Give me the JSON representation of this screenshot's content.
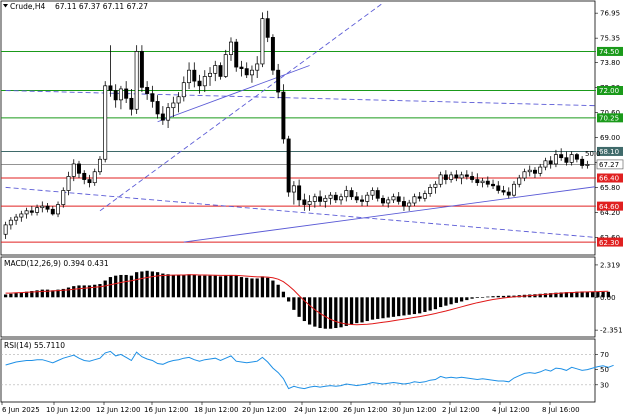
{
  "chart_data": {
    "type": "candlestick",
    "symbol_label": "Crude,H4",
    "ohlc_label": "67.11 67.37 67.11 67.27",
    "price_axis": {
      "ticks": [
        "76.95",
        "75.35",
        "73.80",
        "72.20",
        "70.60",
        "69.00",
        "67.40",
        "65.80",
        "64.20",
        "62.60"
      ],
      "ylim": [
        61.6,
        77.6
      ]
    },
    "x_labels": [
      "6 Jun 2025",
      "10 Jun 12:00",
      "12 Jun 12:00",
      "16 Jun 12:00",
      "18 Jun 12:00",
      "20 Jun 12:00",
      "24 Jun 12:00",
      "26 Jun 12:00",
      "30 Jun 12:00",
      "2 Jul 12:00",
      "4 Jul 12:00",
      "8 Jul 16:00"
    ],
    "levels": [
      {
        "label": "74.50",
        "value": 74.5,
        "color": "#1a9a1a",
        "kind": "resistance"
      },
      {
        "label": "72.00",
        "value": 72.0,
        "color": "#1a9a1a",
        "kind": "resistance"
      },
      {
        "label": "70.25",
        "value": 70.25,
        "color": "#1a9a1a",
        "kind": "resistance"
      },
      {
        "label": "68.10",
        "value": 68.1,
        "color": "#3f6a6a",
        "kind": "fib"
      },
      {
        "label": "67.27",
        "value": 67.27,
        "color": "#555555",
        "kind": "current"
      },
      {
        "label": "66.40",
        "value": 66.4,
        "color": "#e02020",
        "kind": "support"
      },
      {
        "label": "64.60",
        "value": 64.6,
        "color": "#e02020",
        "kind": "support"
      },
      {
        "label": "62.30",
        "value": 62.3,
        "color": "#e02020",
        "kind": "support"
      }
    ],
    "fib_label": "50.0",
    "candles": [
      [
        62.8,
        63.6,
        62.5,
        63.4
      ],
      [
        63.4,
        63.9,
        63.1,
        63.7
      ],
      [
        63.7,
        64.1,
        63.4,
        63.9
      ],
      [
        63.9,
        64.3,
        63.6,
        64.1
      ],
      [
        64.1,
        64.5,
        63.8,
        64.3
      ],
      [
        64.3,
        64.6,
        64.0,
        64.2
      ],
      [
        64.2,
        64.7,
        64.0,
        64.5
      ],
      [
        64.5,
        64.9,
        64.2,
        64.6
      ],
      [
        64.6,
        64.8,
        64.2,
        64.4
      ],
      [
        64.4,
        64.6,
        64.0,
        64.1
      ],
      [
        64.1,
        64.9,
        63.9,
        64.7
      ],
      [
        64.7,
        65.8,
        64.5,
        65.6
      ],
      [
        65.6,
        66.8,
        65.3,
        66.5
      ],
      [
        66.5,
        67.6,
        66.2,
        67.3
      ],
      [
        67.3,
        67.5,
        66.4,
        66.7
      ],
      [
        66.7,
        66.9,
        66.0,
        66.3
      ],
      [
        66.3,
        66.6,
        65.8,
        66.1
      ],
      [
        66.1,
        67.0,
        65.9,
        66.8
      ],
      [
        66.8,
        67.8,
        66.6,
        67.6
      ],
      [
        67.6,
        72.6,
        67.4,
        72.3
      ],
      [
        72.3,
        74.9,
        71.6,
        72.0
      ],
      [
        72.0,
        72.4,
        70.9,
        71.4
      ],
      [
        71.4,
        72.3,
        70.8,
        72.1
      ],
      [
        72.1,
        72.6,
        71.2,
        71.5
      ],
      [
        71.5,
        72.1,
        70.4,
        70.8
      ],
      [
        70.8,
        74.9,
        70.5,
        74.5
      ],
      [
        74.5,
        74.9,
        71.9,
        72.2
      ],
      [
        72.2,
        72.6,
        71.4,
        71.8
      ],
      [
        71.8,
        72.3,
        70.9,
        71.3
      ],
      [
        71.3,
        71.7,
        70.2,
        70.5
      ],
      [
        70.5,
        71.0,
        69.8,
        70.1
      ],
      [
        70.1,
        71.2,
        69.6,
        70.9
      ],
      [
        70.9,
        71.6,
        70.3,
        71.2
      ],
      [
        71.2,
        71.9,
        70.6,
        71.6
      ],
      [
        71.6,
        72.9,
        71.3,
        72.5
      ],
      [
        72.5,
        73.8,
        72.1,
        73.3
      ],
      [
        73.3,
        73.8,
        72.2,
        72.6
      ],
      [
        72.6,
        73.0,
        71.8,
        72.3
      ],
      [
        72.3,
        73.3,
        71.9,
        72.9
      ],
      [
        72.9,
        73.5,
        72.3,
        73.1
      ],
      [
        73.1,
        73.9,
        72.6,
        73.6
      ],
      [
        73.6,
        73.8,
        72.7,
        72.9
      ],
      [
        72.9,
        74.6,
        72.8,
        74.3
      ],
      [
        74.3,
        75.4,
        73.9,
        75.1
      ],
      [
        75.1,
        75.3,
        73.2,
        73.5
      ],
      [
        73.5,
        73.9,
        72.9,
        73.4
      ],
      [
        73.4,
        73.8,
        72.8,
        73.0
      ],
      [
        73.0,
        73.6,
        72.5,
        73.3
      ],
      [
        73.3,
        74.2,
        72.8,
        73.7
      ],
      [
        73.7,
        77.0,
        73.5,
        76.6
      ],
      [
        76.6,
        77.1,
        75.1,
        75.4
      ],
      [
        75.4,
        75.6,
        73.0,
        73.3
      ],
      [
        73.3,
        73.7,
        71.5,
        71.9
      ],
      [
        71.9,
        72.4,
        68.6,
        68.9
      ],
      [
        68.9,
        69.1,
        65.2,
        65.5
      ],
      [
        65.5,
        66.2,
        64.7,
        65.9
      ],
      [
        65.9,
        66.3,
        64.6,
        65.0
      ],
      [
        65.0,
        65.4,
        64.3,
        64.7
      ],
      [
        64.7,
        65.3,
        64.3,
        64.9
      ],
      [
        64.9,
        65.4,
        64.5,
        65.2
      ],
      [
        65.2,
        65.6,
        64.6,
        64.9
      ],
      [
        64.9,
        65.3,
        64.5,
        65.1
      ],
      [
        65.1,
        65.5,
        64.7,
        65.3
      ],
      [
        65.3,
        65.5,
        64.8,
        65.0
      ],
      [
        65.0,
        65.4,
        64.7,
        65.2
      ],
      [
        65.2,
        65.9,
        64.9,
        65.6
      ],
      [
        65.6,
        65.8,
        65.0,
        65.2
      ],
      [
        65.2,
        65.5,
        64.8,
        65.0
      ],
      [
        65.0,
        65.3,
        64.6,
        64.9
      ],
      [
        64.9,
        65.5,
        64.6,
        65.3
      ],
      [
        65.3,
        65.8,
        65.0,
        65.6
      ],
      [
        65.6,
        65.8,
        64.9,
        65.1
      ],
      [
        65.1,
        65.3,
        64.6,
        64.8
      ],
      [
        64.8,
        65.2,
        64.5,
        65.0
      ],
      [
        65.0,
        65.4,
        64.8,
        65.2
      ],
      [
        65.2,
        65.5,
        64.7,
        64.9
      ],
      [
        64.9,
        65.2,
        64.3,
        64.6
      ],
      [
        64.6,
        65.0,
        64.3,
        64.8
      ],
      [
        64.8,
        65.4,
        64.6,
        65.2
      ],
      [
        65.2,
        65.5,
        64.9,
        65.1
      ],
      [
        65.1,
        65.6,
        64.9,
        65.4
      ],
      [
        65.4,
        66.0,
        65.2,
        65.8
      ],
      [
        65.8,
        66.2,
        65.4,
        66.0
      ],
      [
        66.0,
        66.8,
        65.8,
        66.6
      ],
      [
        66.6,
        66.9,
        66.0,
        66.3
      ],
      [
        66.3,
        66.8,
        66.1,
        66.6
      ],
      [
        66.6,
        66.9,
        66.2,
        66.4
      ],
      [
        66.4,
        66.8,
        66.0,
        66.6
      ],
      [
        66.6,
        66.9,
        66.3,
        66.5
      ],
      [
        66.5,
        66.8,
        66.1,
        66.3
      ],
      [
        66.3,
        66.7,
        65.9,
        66.1
      ],
      [
        66.1,
        66.4,
        65.8,
        66.2
      ],
      [
        66.2,
        66.5,
        65.8,
        66.0
      ],
      [
        66.0,
        66.3,
        65.7,
        65.9
      ],
      [
        65.9,
        66.2,
        65.4,
        65.6
      ],
      [
        65.6,
        65.9,
        65.3,
        65.5
      ],
      [
        65.5,
        65.8,
        65.1,
        65.3
      ],
      [
        65.3,
        66.2,
        65.2,
        66.0
      ],
      [
        66.0,
        66.6,
        65.8,
        66.4
      ],
      [
        66.4,
        67.0,
        66.2,
        66.8
      ],
      [
        66.8,
        67.2,
        66.5,
        66.9
      ],
      [
        66.9,
        67.1,
        66.4,
        66.7
      ],
      [
        66.7,
        67.3,
        66.5,
        67.1
      ],
      [
        67.1,
        67.7,
        66.9,
        67.5
      ],
      [
        67.5,
        67.8,
        67.0,
        67.3
      ],
      [
        67.3,
        68.2,
        67.1,
        67.9
      ],
      [
        67.9,
        68.3,
        67.5,
        67.7
      ],
      [
        67.7,
        68.1,
        67.2,
        67.4
      ],
      [
        67.4,
        68.1,
        67.2,
        67.9
      ],
      [
        67.9,
        68.0,
        67.4,
        67.6
      ],
      [
        67.6,
        67.8,
        67.0,
        67.2
      ],
      [
        67.2,
        67.5,
        67.0,
        67.27
      ]
    ],
    "trendlines": [
      {
        "name": "up-channel-dashed",
        "from": [
          18,
          64.3
        ],
        "to": [
          72,
          77.6
        ],
        "style": "dashed",
        "color": "#5b5bd6"
      },
      {
        "name": "up-trend-solid",
        "from": [
          29,
          70.0
        ],
        "to": [
          58,
          73.6
        ],
        "style": "solid",
        "color": "#5b5bd6"
      },
      {
        "name": "upper-falling-dashed",
        "from": [
          0,
          72.0
        ],
        "to": [
          116,
          71.0
        ],
        "style": "dashed",
        "color": "#5b5bd6"
      },
      {
        "name": "lower-falling-dashed",
        "from": [
          0,
          65.8
        ],
        "to": [
          116,
          62.5
        ],
        "style": "dashed",
        "color": "#5b5bd6"
      },
      {
        "name": "support-solid",
        "from": [
          34,
          62.3
        ],
        "to": [
          116,
          66.0
        ],
        "style": "solid",
        "color": "#5b5bd6"
      }
    ],
    "macd": {
      "label": "MACD(12,26,9) 0.394 0.431",
      "ticks": [
        "2.319",
        "0.00",
        "-2.351"
      ],
      "ylim": [
        -2.7,
        2.6
      ],
      "hist": [
        0.2,
        0.25,
        0.3,
        0.35,
        0.4,
        0.45,
        0.5,
        0.55,
        0.55,
        0.5,
        0.55,
        0.6,
        0.7,
        0.8,
        0.85,
        0.85,
        0.85,
        0.9,
        0.95,
        1.2,
        1.45,
        1.55,
        1.6,
        1.6,
        1.55,
        1.8,
        1.85,
        1.9,
        1.85,
        1.8,
        1.7,
        1.65,
        1.6,
        1.6,
        1.6,
        1.65,
        1.6,
        1.55,
        1.55,
        1.55,
        1.55,
        1.5,
        1.55,
        1.6,
        1.55,
        1.45,
        1.4,
        1.35,
        1.35,
        1.5,
        1.4,
        1.2,
        0.9,
        0.4,
        -0.3,
        -0.9,
        -1.4,
        -1.7,
        -1.95,
        -2.1,
        -2.2,
        -2.25,
        -2.25,
        -2.2,
        -2.15,
        -2.05,
        -1.95,
        -1.85,
        -1.8,
        -1.7,
        -1.6,
        -1.55,
        -1.5,
        -1.45,
        -1.4,
        -1.35,
        -1.3,
        -1.25,
        -1.2,
        -1.15,
        -1.05,
        -0.95,
        -0.85,
        -0.7,
        -0.6,
        -0.5,
        -0.4,
        -0.3,
        -0.2,
        -0.1,
        -0.05,
        0.0,
        0.05,
        0.08,
        0.1,
        0.1,
        0.12,
        0.12,
        0.15,
        0.18,
        0.2,
        0.22,
        0.25,
        0.28,
        0.3,
        0.33,
        0.35,
        0.37,
        0.38,
        0.4,
        0.42,
        0.4,
        0.4,
        0.39,
        0.394,
        0.394
      ],
      "signal": [
        0.3,
        0.3,
        0.32,
        0.34,
        0.36,
        0.38,
        0.4,
        0.42,
        0.44,
        0.46,
        0.48,
        0.5,
        0.53,
        0.57,
        0.61,
        0.65,
        0.68,
        0.72,
        0.76,
        0.82,
        0.9,
        0.98,
        1.06,
        1.13,
        1.19,
        1.27,
        1.35,
        1.42,
        1.48,
        1.53,
        1.56,
        1.58,
        1.59,
        1.6,
        1.6,
        1.61,
        1.61,
        1.6,
        1.6,
        1.59,
        1.58,
        1.57,
        1.57,
        1.57,
        1.57,
        1.55,
        1.52,
        1.49,
        1.46,
        1.46,
        1.45,
        1.4,
        1.3,
        1.12,
        0.84,
        0.5,
        0.12,
        -0.24,
        -0.58,
        -0.88,
        -1.15,
        -1.38,
        -1.58,
        -1.73,
        -1.84,
        -1.91,
        -1.95,
        -1.96,
        -1.95,
        -1.93,
        -1.89,
        -1.84,
        -1.79,
        -1.74,
        -1.68,
        -1.62,
        -1.56,
        -1.5,
        -1.44,
        -1.38,
        -1.31,
        -1.24,
        -1.16,
        -1.07,
        -0.98,
        -0.88,
        -0.78,
        -0.68,
        -0.58,
        -0.48,
        -0.39,
        -0.31,
        -0.23,
        -0.16,
        -0.1,
        -0.05,
        -0.01,
        0.03,
        0.06,
        0.09,
        0.12,
        0.15,
        0.18,
        0.21,
        0.24,
        0.27,
        0.3,
        0.32,
        0.34,
        0.36,
        0.38,
        0.39,
        0.4,
        0.41,
        0.42,
        0.431
      ]
    },
    "rsi": {
      "label": "RSI(14) 55.7110",
      "ticks": [
        "70",
        "50",
        "30"
      ],
      "ylim": [
        10,
        85
      ],
      "values": [
        56,
        58,
        60,
        61,
        62,
        62,
        63,
        63,
        61,
        59,
        62,
        65,
        67,
        69,
        65,
        62,
        61,
        63,
        65,
        72,
        74,
        68,
        70,
        66,
        62,
        73,
        67,
        64,
        62,
        58,
        57,
        60,
        62,
        63,
        65,
        66,
        63,
        61,
        63,
        64,
        65,
        62,
        65,
        68,
        61,
        60,
        59,
        60,
        61,
        66,
        60,
        52,
        46,
        38,
        25,
        28,
        26,
        25,
        27,
        28,
        27,
        28,
        29,
        28,
        29,
        31,
        30,
        29,
        30,
        31,
        33,
        32,
        31,
        32,
        33,
        32,
        31,
        32,
        34,
        33,
        34,
        36,
        37,
        41,
        39,
        40,
        39,
        40,
        39,
        38,
        37,
        38,
        37,
        36,
        35,
        35,
        34,
        39,
        42,
        45,
        46,
        45,
        47,
        50,
        48,
        52,
        51,
        49,
        53,
        51,
        49,
        50,
        52,
        54,
        55,
        53,
        55.7
      ]
    }
  }
}
